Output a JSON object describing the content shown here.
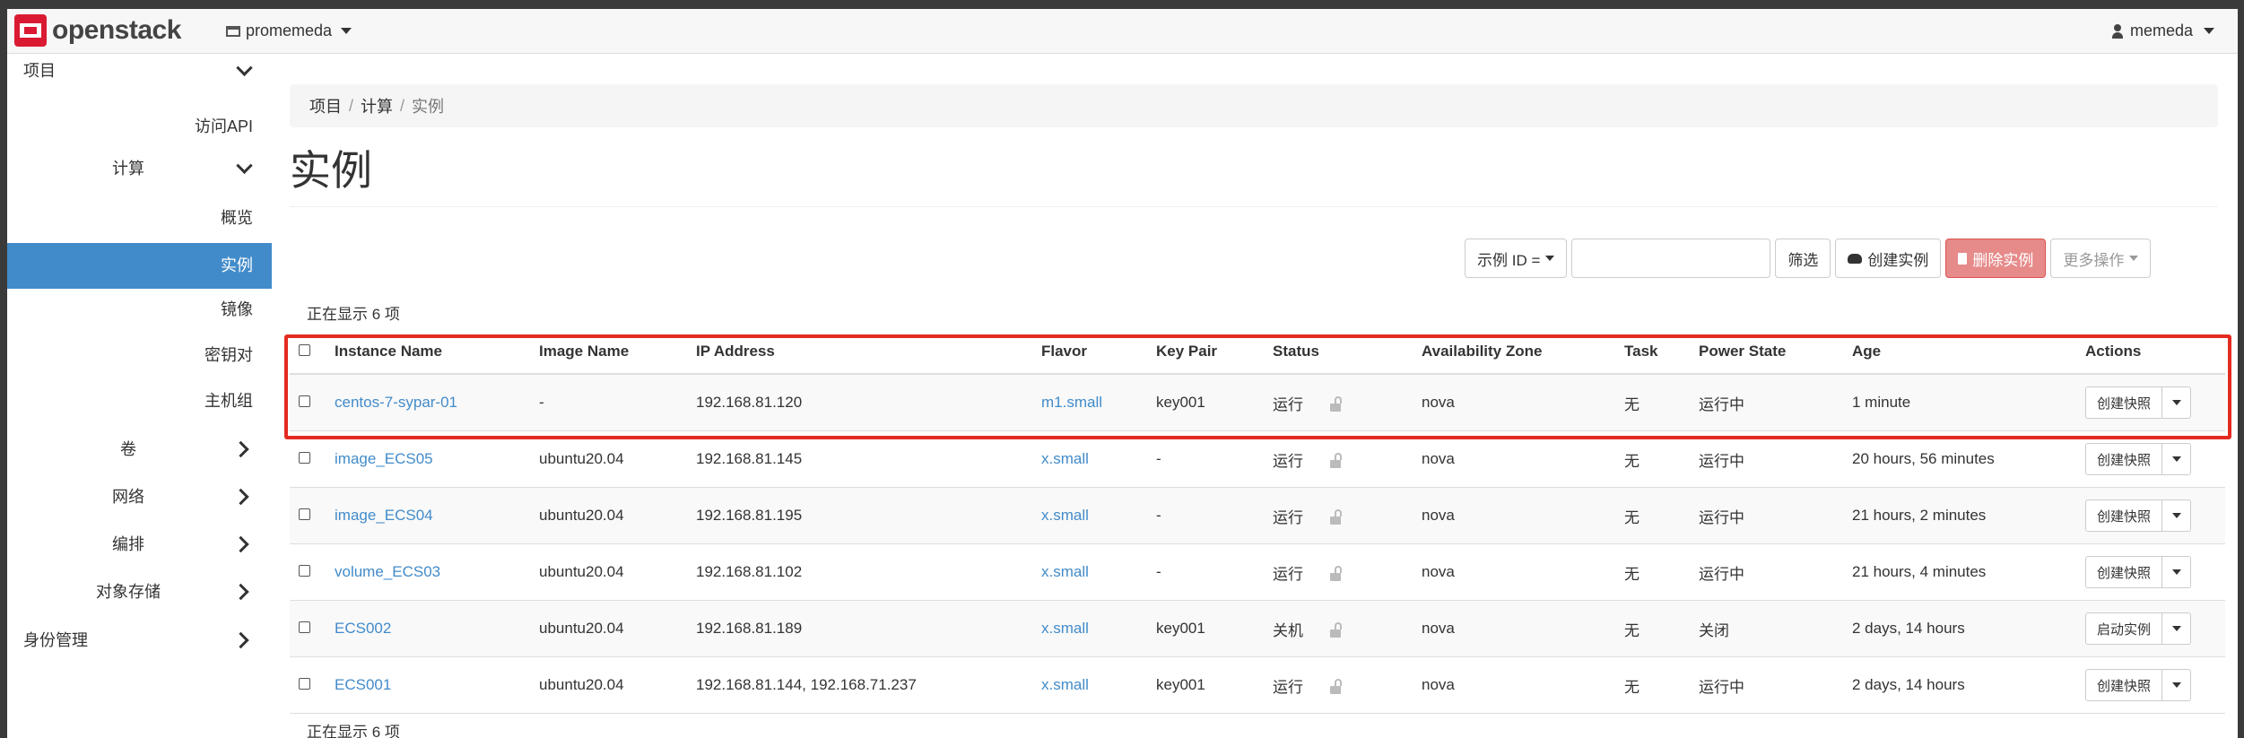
{
  "navbar": {
    "logo_text": "openstack",
    "project": "promemeda",
    "user": "memeda"
  },
  "sidebar": {
    "project": "项目",
    "access_api": "访问API",
    "compute": "计算",
    "overview": "概览",
    "instances": "实例",
    "images": "镜像",
    "key_pairs": "密钥对",
    "server_groups": "主机组",
    "volumes": "卷",
    "network": "网络",
    "orchestration": "编排",
    "object_store": "对象存储",
    "identity": "身份管理"
  },
  "breadcrumb": [
    "项目",
    "计算",
    "实例"
  ],
  "page_title": "实例",
  "toolbar": {
    "filter_field": "示例 ID =",
    "filter_value": "",
    "filter_btn": "筛选",
    "create_btn": "创建实例",
    "delete_btn": "删除实例",
    "more_btn": "更多操作"
  },
  "count_text": "正在显示 6 项",
  "columns": [
    "Instance Name",
    "Image Name",
    "IP Address",
    "Flavor",
    "Key Pair",
    "Status",
    "Availability Zone",
    "Task",
    "Power State",
    "Age",
    "Actions"
  ],
  "rows": [
    {
      "name": "centos-7-sypar-01",
      "image": "-",
      "ip": "192.168.81.120",
      "flavor": "m1.small",
      "keypair": "key001",
      "status": "运行",
      "zone": "nova",
      "task": "无",
      "power": "运行中",
      "age": "1 minute",
      "action": "创建快照"
    },
    {
      "name": "image_ECS05",
      "image": "ubuntu20.04",
      "ip": "192.168.81.145",
      "flavor": "x.small",
      "keypair": "-",
      "status": "运行",
      "zone": "nova",
      "task": "无",
      "power": "运行中",
      "age": "20 hours, 56 minutes",
      "action": "创建快照"
    },
    {
      "name": "image_ECS04",
      "image": "ubuntu20.04",
      "ip": "192.168.81.195",
      "flavor": "x.small",
      "keypair": "-",
      "status": "运行",
      "zone": "nova",
      "task": "无",
      "power": "运行中",
      "age": "21 hours, 2 minutes",
      "action": "创建快照"
    },
    {
      "name": "volume_ECS03",
      "image": "ubuntu20.04",
      "ip": "192.168.81.102",
      "flavor": "x.small",
      "keypair": "-",
      "status": "运行",
      "zone": "nova",
      "task": "无",
      "power": "运行中",
      "age": "21 hours, 4 minutes",
      "action": "创建快照"
    },
    {
      "name": "ECS002",
      "image": "ubuntu20.04",
      "ip": "192.168.81.189",
      "flavor": "x.small",
      "keypair": "key001",
      "status": "关机",
      "zone": "nova",
      "task": "无",
      "power": "关闭",
      "age": "2 days, 14 hours",
      "action": "启动实例"
    },
    {
      "name": "ECS001",
      "image": "ubuntu20.04",
      "ip": "192.168.81.144, 192.168.71.237",
      "flavor": "x.small",
      "keypair": "key001",
      "status": "运行",
      "zone": "nova",
      "task": "无",
      "power": "运行中",
      "age": "2 days, 14 hours",
      "action": "创建快照"
    }
  ],
  "colors": {
    "accent": "#428bca",
    "danger": "#d9534f",
    "highlight": "#e32b20",
    "brand": "#da1a32"
  }
}
